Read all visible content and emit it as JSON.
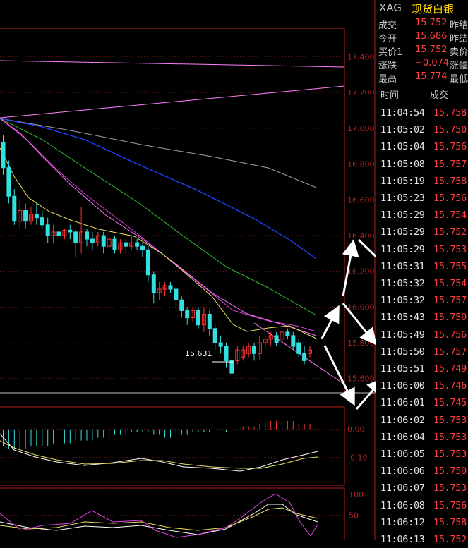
{
  "colors": {
    "up": "#ff3333",
    "down": "#33e0e0",
    "grid": "#b02020",
    "text": "#c8c8c8",
    "price": "#ff4040",
    "gold": "#ffd700"
  },
  "header": {
    "symbol": "XAG",
    "name": "现货白银"
  },
  "quote": [
    {
      "label": "成交",
      "value": "15.752",
      "extra": "昨结"
    },
    {
      "label": "今开",
      "value": "15.686",
      "extra": "昨结"
    },
    {
      "label": "买价1",
      "value": "15.752",
      "extra": "卖价"
    },
    {
      "label": "涨跌",
      "value": "+0.074",
      "extra": "涨幅"
    },
    {
      "label": "最高",
      "value": "15.774",
      "extra": "最低"
    }
  ],
  "tick_header": {
    "time": "时间",
    "price": "成交"
  },
  "ticks": [
    {
      "time": "11:04:54",
      "price": "15.758"
    },
    {
      "time": "11:05:02",
      "price": "15.750"
    },
    {
      "time": "11:05:04",
      "price": "15.756"
    },
    {
      "time": "11:05:08",
      "price": "15.757"
    },
    {
      "time": "11:05:19",
      "price": "15.758"
    },
    {
      "time": "11:05:23",
      "price": "15.756"
    },
    {
      "time": "11:05:29",
      "price": "15.754"
    },
    {
      "time": "11:05:29",
      "price": "15.752"
    },
    {
      "time": "11:05:29",
      "price": "15.753"
    },
    {
      "time": "11:05:31",
      "price": "15.755"
    },
    {
      "time": "11:05:32",
      "price": "15.754"
    },
    {
      "time": "11:05:32",
      "price": "15.757"
    },
    {
      "time": "11:05:43",
      "price": "15.750"
    },
    {
      "time": "11:05:49",
      "price": "15.756"
    },
    {
      "time": "11:05:50",
      "price": "15.757"
    },
    {
      "time": "11:05:51",
      "price": "15.749"
    },
    {
      "time": "11:06:00",
      "price": "15.746"
    },
    {
      "time": "11:06:01",
      "price": "15.745"
    },
    {
      "time": "11:06:02",
      "price": "15.753"
    },
    {
      "time": "11:06:04",
      "price": "15.753"
    },
    {
      "time": "11:06:05",
      "price": "15.753"
    },
    {
      "time": "11:06:06",
      "price": "15.750"
    },
    {
      "time": "11:06:07",
      "price": "15.753"
    },
    {
      "time": "11:06:08",
      "price": "15.756"
    },
    {
      "time": "11:06:12",
      "price": "15.758"
    },
    {
      "time": "11:06:13",
      "price": "15.752"
    }
  ],
  "chart_data": [
    {
      "type": "candlestick",
      "ylim": [
        15.52,
        17.56
      ],
      "y_ticks": [
        "17.400",
        "17.200",
        "17.000",
        "16.800",
        "16.600",
        "16.400",
        "16.200",
        "16.000",
        "15.800",
        "15.600"
      ],
      "y_tick_values": [
        17.4,
        17.2,
        17.0,
        16.8,
        16.6,
        16.4,
        16.2,
        16.0,
        15.8,
        15.6
      ],
      "annotation": {
        "text": "15.631",
        "value": 15.631
      },
      "candles": [
        {
          "o": 16.92,
          "c": 16.78,
          "h": 16.96,
          "l": 16.74
        },
        {
          "o": 16.78,
          "c": 16.62,
          "h": 16.82,
          "l": 16.58
        },
        {
          "o": 16.62,
          "c": 16.48,
          "h": 16.66,
          "l": 16.46
        },
        {
          "o": 16.48,
          "c": 16.54,
          "h": 16.6,
          "l": 16.44
        },
        {
          "o": 16.54,
          "c": 16.48,
          "h": 16.58,
          "l": 16.44
        },
        {
          "o": 16.48,
          "c": 16.52,
          "h": 16.56,
          "l": 16.46
        },
        {
          "o": 16.52,
          "c": 16.5,
          "h": 16.58,
          "l": 16.46
        },
        {
          "o": 16.5,
          "c": 16.46,
          "h": 16.54,
          "l": 16.44
        },
        {
          "o": 16.46,
          "c": 16.4,
          "h": 16.5,
          "l": 16.36
        },
        {
          "o": 16.4,
          "c": 16.42,
          "h": 16.46,
          "l": 16.36
        },
        {
          "o": 16.42,
          "c": 16.4,
          "h": 16.48,
          "l": 16.32
        },
        {
          "o": 16.4,
          "c": 16.43,
          "h": 16.44,
          "l": 16.38
        },
        {
          "o": 16.43,
          "c": 16.42,
          "h": 16.46,
          "l": 16.38
        },
        {
          "o": 16.42,
          "c": 16.36,
          "h": 16.44,
          "l": 16.28
        },
        {
          "o": 16.36,
          "c": 16.42,
          "h": 16.56,
          "l": 16.3
        },
        {
          "o": 16.42,
          "c": 16.38,
          "h": 16.44,
          "l": 16.34
        },
        {
          "o": 16.38,
          "c": 16.36,
          "h": 16.42,
          "l": 16.32
        },
        {
          "o": 16.36,
          "c": 16.4,
          "h": 16.42,
          "l": 16.34
        },
        {
          "o": 16.4,
          "c": 16.34,
          "h": 16.42,
          "l": 16.3
        },
        {
          "o": 16.34,
          "c": 16.38,
          "h": 16.4,
          "l": 16.32
        },
        {
          "o": 16.38,
          "c": 16.32,
          "h": 16.4,
          "l": 16.3
        },
        {
          "o": 16.32,
          "c": 16.36,
          "h": 16.38,
          "l": 16.3
        },
        {
          "o": 16.36,
          "c": 16.34,
          "h": 16.38,
          "l": 16.3
        },
        {
          "o": 16.34,
          "c": 16.36,
          "h": 16.4,
          "l": 16.32
        },
        {
          "o": 16.36,
          "c": 16.34,
          "h": 16.38,
          "l": 16.32
        },
        {
          "o": 16.34,
          "c": 16.32,
          "h": 16.36,
          "l": 16.28
        },
        {
          "o": 16.32,
          "c": 16.18,
          "h": 16.34,
          "l": 16.14
        },
        {
          "o": 16.18,
          "c": 16.08,
          "h": 16.2,
          "l": 16.02
        },
        {
          "o": 16.08,
          "c": 16.1,
          "h": 16.14,
          "l": 16.04
        },
        {
          "o": 16.1,
          "c": 16.12,
          "h": 16.14,
          "l": 16.06
        },
        {
          "o": 16.12,
          "c": 16.1,
          "h": 16.14,
          "l": 16.08
        },
        {
          "o": 16.1,
          "c": 16.04,
          "h": 16.12,
          "l": 16.0
        },
        {
          "o": 16.04,
          "c": 15.98,
          "h": 16.06,
          "l": 15.94
        },
        {
          "o": 15.98,
          "c": 15.94,
          "h": 16.0,
          "l": 15.9
        },
        {
          "o": 15.94,
          "c": 15.98,
          "h": 16.0,
          "l": 15.92
        },
        {
          "o": 15.98,
          "c": 15.9,
          "h": 16.0,
          "l": 15.88
        },
        {
          "o": 15.9,
          "c": 15.96,
          "h": 16.0,
          "l": 15.86
        },
        {
          "o": 15.96,
          "c": 15.88,
          "h": 15.98,
          "l": 15.84
        },
        {
          "o": 15.88,
          "c": 15.8,
          "h": 15.9,
          "l": 15.76
        },
        {
          "o": 15.8,
          "c": 15.78,
          "h": 15.84,
          "l": 15.74
        },
        {
          "o": 15.78,
          "c": 15.7,
          "h": 15.8,
          "l": 15.66
        },
        {
          "o": 15.7,
          "c": 15.63,
          "h": 15.72,
          "l": 15.63
        },
        {
          "o": 15.7,
          "c": 15.76,
          "h": 15.78,
          "l": 15.68
        },
        {
          "o": 15.72,
          "c": 15.76,
          "h": 15.78,
          "l": 15.7
        },
        {
          "o": 15.74,
          "c": 15.78,
          "h": 15.8,
          "l": 15.72
        },
        {
          "o": 15.78,
          "c": 15.74,
          "h": 15.8,
          "l": 15.7
        },
        {
          "o": 15.74,
          "c": 15.8,
          "h": 15.84,
          "l": 15.7
        },
        {
          "o": 15.8,
          "c": 15.82,
          "h": 15.84,
          "l": 15.78
        },
        {
          "o": 15.82,
          "c": 15.84,
          "h": 15.86,
          "l": 15.78
        },
        {
          "o": 15.84,
          "c": 15.8,
          "h": 15.86,
          "l": 15.78
        },
        {
          "o": 15.82,
          "c": 15.86,
          "h": 15.88,
          "l": 15.8
        },
        {
          "o": 15.86,
          "c": 15.84,
          "h": 15.88,
          "l": 15.82
        },
        {
          "o": 15.84,
          "c": 15.78,
          "h": 15.86,
          "l": 15.76
        },
        {
          "o": 15.8,
          "c": 15.74,
          "h": 15.82,
          "l": 15.72
        },
        {
          "o": 15.74,
          "c": 15.7,
          "h": 15.78,
          "l": 15.68
        },
        {
          "o": 15.74,
          "c": 15.76,
          "h": 15.78,
          "l": 15.72
        }
      ]
    },
    {
      "type": "bar",
      "y_ticks": [
        "0.00",
        "-0.10"
      ],
      "y_tick_values": [
        0.0,
        -0.1
      ],
      "ylim": [
        -0.2,
        0.08
      ],
      "values": [
        -0.06,
        -0.07,
        -0.07,
        -0.07,
        -0.07,
        -0.06,
        -0.06,
        -0.06,
        -0.06,
        -0.05,
        -0.05,
        -0.05,
        -0.05,
        -0.04,
        -0.04,
        -0.04,
        -0.04,
        -0.03,
        -0.03,
        -0.03,
        -0.02,
        -0.02,
        -0.02,
        -0.01,
        -0.01,
        -0.01,
        -0.01,
        -0.02,
        -0.02,
        -0.03,
        -0.03,
        -0.02,
        -0.02,
        -0.02,
        -0.01,
        -0.01,
        -0.01,
        -0.01,
        0.0,
        0.0,
        -0.01,
        -0.01,
        0.0,
        0.01,
        0.01,
        0.01,
        0.02,
        0.02,
        0.03,
        0.03,
        0.03,
        0.03,
        0.03,
        0.02,
        0.02,
        0.02
      ]
    },
    {
      "type": "line",
      "y_ticks": [
        "100",
        "50"
      ],
      "y_tick_values": [
        100,
        50
      ],
      "ylim": [
        -10,
        115
      ]
    }
  ]
}
